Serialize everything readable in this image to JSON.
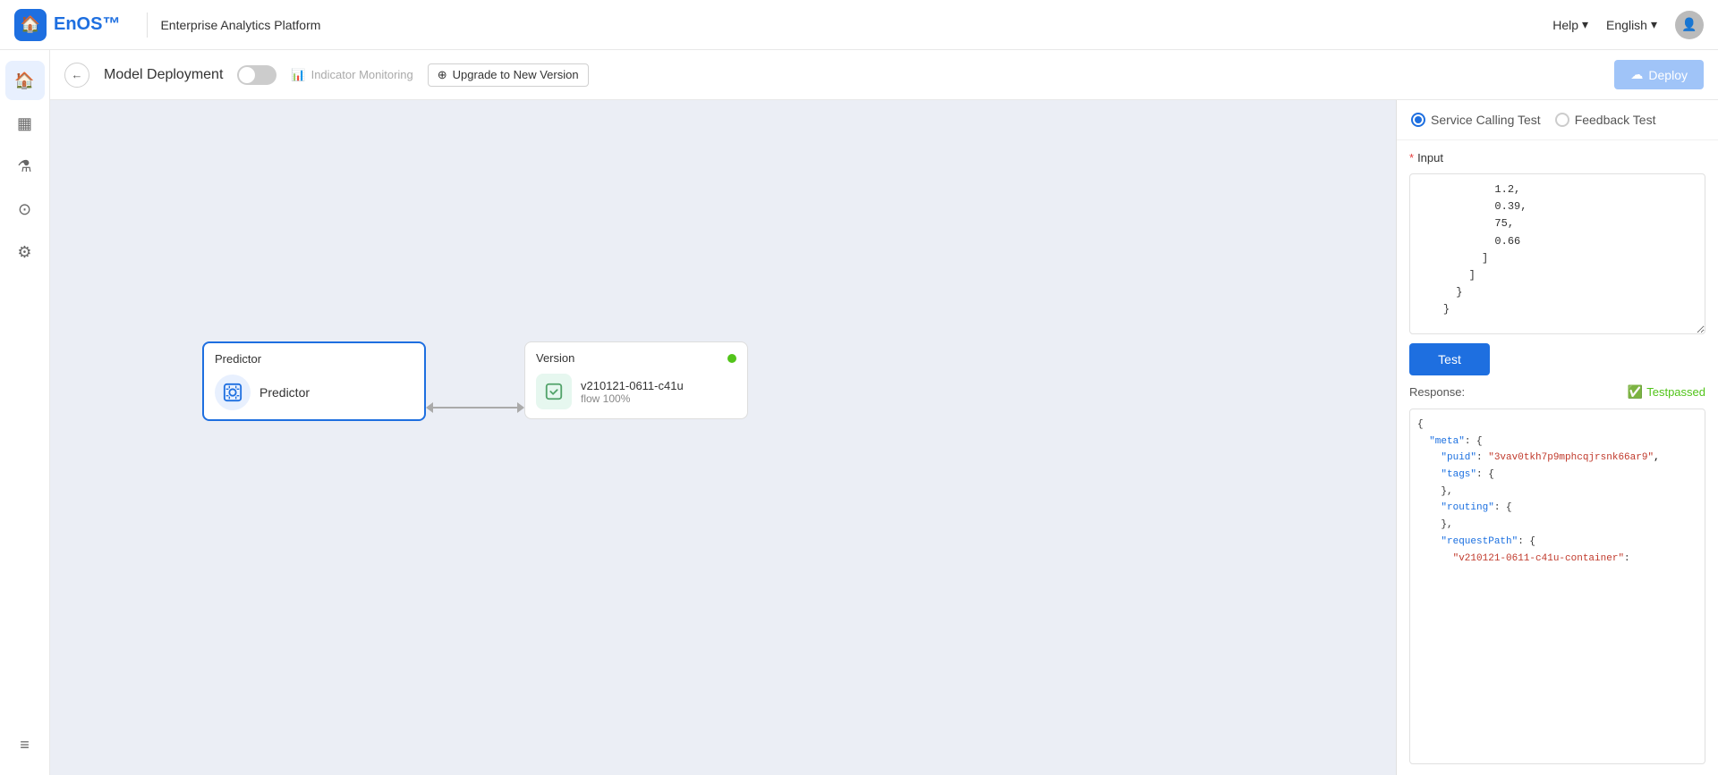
{
  "topNav": {
    "platformTitle": "Enterprise Analytics Platform",
    "helpLabel": "Help",
    "langLabel": "English",
    "avatarInitial": ""
  },
  "subHeader": {
    "pageTitle": "Model Deployment",
    "indicatorLabel": "Indicator Monitoring",
    "upgradeLabel": "Upgrade to New Version",
    "deployLabel": "Deploy"
  },
  "sidebar": {
    "items": [
      {
        "icon": "⊞",
        "name": "home",
        "active": true
      },
      {
        "icon": "▦",
        "name": "dashboard",
        "active": false
      },
      {
        "icon": "⚗",
        "name": "lab",
        "active": false
      },
      {
        "icon": "⊙",
        "name": "data",
        "active": false
      },
      {
        "icon": "⚙",
        "name": "settings",
        "active": false
      }
    ],
    "bottomIcon": "≡"
  },
  "canvas": {
    "predictorNode": {
      "title": "Predictor",
      "label": "Predictor"
    },
    "versionNode": {
      "title": "Version",
      "versionId": "v210121-0611-c41u",
      "flow": "flow 100%"
    }
  },
  "rightPanel": {
    "tabs": [
      {
        "label": "Service Calling Test",
        "active": true
      },
      {
        "label": "Feedback Test",
        "active": false
      }
    ],
    "inputLabel": "* Input",
    "inputValue": "            1.2,\n            0.39,\n            75,\n            0.66\n          ]\n        ]\n      }\n    }",
    "testButtonLabel": "Test",
    "responseLabel": "Response:",
    "testPassedLabel": "Testpassed",
    "responseContent": "{\n  \"meta\": {\n    \"puid\": \"3vav0tkh7p9mphcqjrsnk66ar9\",\n    \"tags\": {\n    },\n    \"routing\": {\n    },\n    \"requestPath\": {\n      \"v210121-0611-c41u-container\":"
  }
}
